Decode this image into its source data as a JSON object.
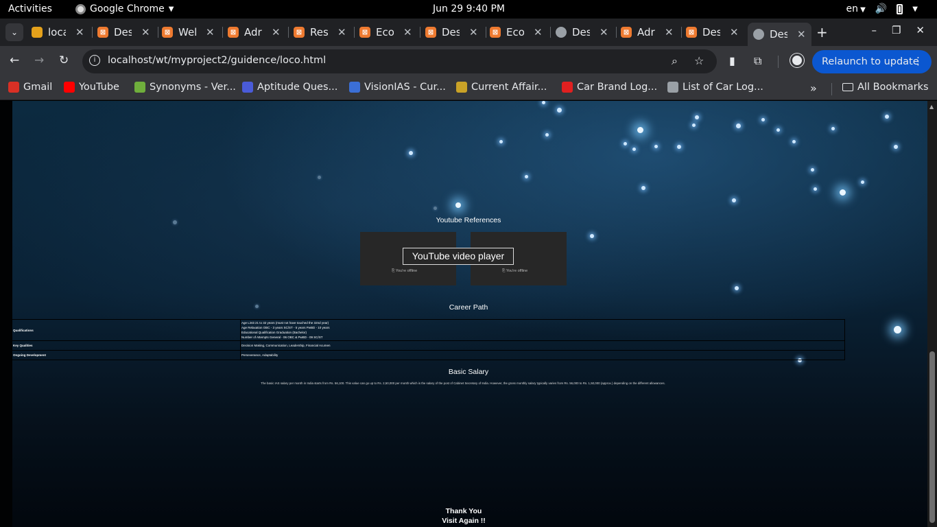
{
  "topbar": {
    "activities": "Activities",
    "app_name": "Google Chrome",
    "clock": "Jun 29  9:40 PM",
    "keyboard_layout": "en"
  },
  "tabs": [
    {
      "title": "loca",
      "icon": "stack-icon"
    },
    {
      "title": "Des",
      "icon": "xampp-icon"
    },
    {
      "title": "Wel",
      "icon": "xampp-icon"
    },
    {
      "title": "Adr",
      "icon": "xampp-icon"
    },
    {
      "title": "Res",
      "icon": "xampp-icon"
    },
    {
      "title": "Eco",
      "icon": "xampp-icon"
    },
    {
      "title": "Des",
      "icon": "xampp-icon"
    },
    {
      "title": "Eco",
      "icon": "xampp-icon"
    },
    {
      "title": "Des",
      "icon": "globe-icon"
    },
    {
      "title": "Adr",
      "icon": "xampp-icon"
    },
    {
      "title": "Des",
      "icon": "xampp-icon"
    },
    {
      "title": "Des",
      "icon": "globe-icon",
      "active": true
    }
  ],
  "toolbar": {
    "url": "localhost/wt/myproject2/guidence/loco.html",
    "relaunch_label": "Relaunch to update"
  },
  "bookmarks": [
    {
      "label": "Gmail",
      "color": "#d93025"
    },
    {
      "label": "YouTube",
      "color": "#ff0000"
    },
    {
      "label": "Synonyms - Ver...",
      "color": "#6fae3c"
    },
    {
      "label": "Aptitude Ques...",
      "color": "#4a5bd8"
    },
    {
      "label": "VisionIAS - Cur...",
      "color": "#3b6fd6"
    },
    {
      "label": "Current Affair...",
      "color": "#c9a227"
    },
    {
      "label": "Car Brand Log...",
      "color": "#e02020"
    },
    {
      "label": "List of Car Log...",
      "color": "#9aa0a6"
    }
  ],
  "bookmarks_all": "All Bookmarks",
  "page": {
    "youtube_heading": "Youtube References",
    "youtube_player_label": "YouTube video player",
    "offline_text": "You're offline",
    "career_heading": "Career Path",
    "career_rows": [
      {
        "key": "Qualifications",
        "lines": [
          "Age Limit 21 to 32 years (must not have touched the 32nd year)",
          "Age Relaxation OBC - 3 years SC/ST - 5 years PwBD - 10 years",
          "Educational Qualification Graduation (Bachelor)",
          "Number of Attempts General - 06 OBC & PwBD - 09 SC/ST"
        ]
      },
      {
        "key": "Key Qualities",
        "lines": [
          "Decision Making, Communication, Leadership, Financial Acumen"
        ]
      },
      {
        "key": "Ongoing Development",
        "lines": [
          "Perseverance, Adaptability"
        ]
      }
    ],
    "salary_heading": "Basic Salary",
    "salary_text": "The basic IAS salary per month in India starts from Rs. 56,100. This value can go up to Rs. 2,50,000 per month which is the salary of the post of Cabinet Secretary of India. However, the gross monthly salary typically varies from Rs. 56,000 to Rs. 1,50,000 (approx.) depending on the different allowances.",
    "thanks_line1": "Thank You",
    "thanks_line2": "Visit Again !!"
  }
}
